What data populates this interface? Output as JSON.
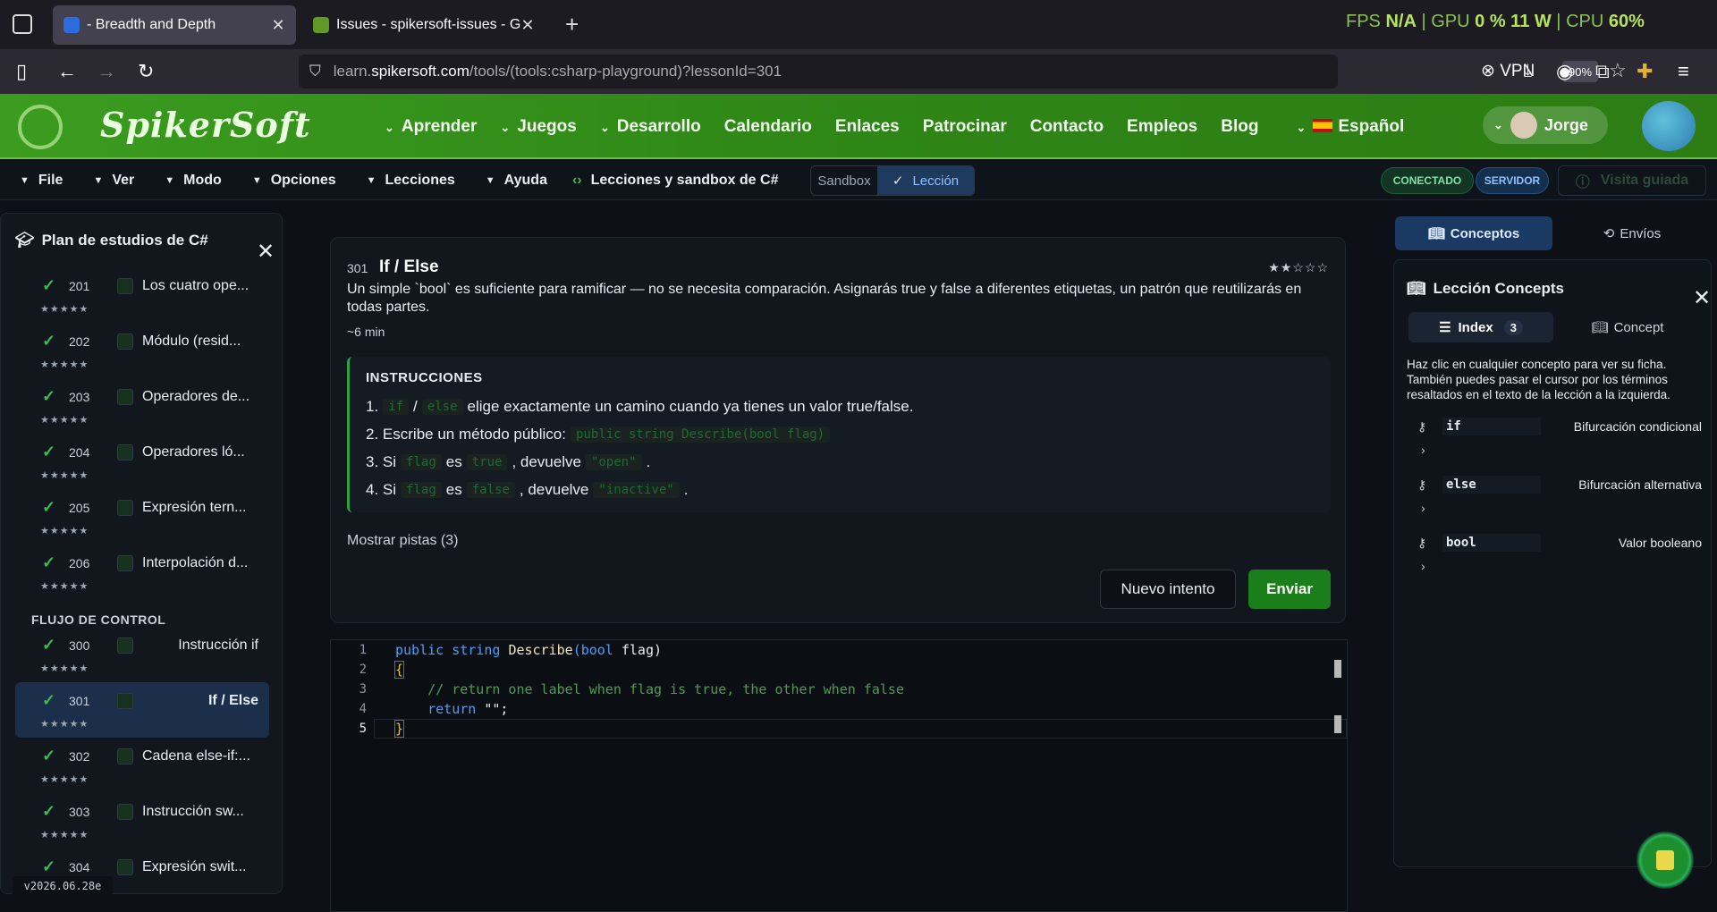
{
  "browser": {
    "tabs": [
      {
        "title": "- Breadth and Depth",
        "active": true,
        "favicon": "spikersoft-icon"
      },
      {
        "title": "Issues - spikersoft-issues - Gitea",
        "active": false,
        "favicon": "gitea-icon"
      }
    ],
    "url_prefix": "learn.",
    "url_domain": "spikersoft.com",
    "url_path": "/tools/(tools:csharp-playground)?lessonId=301",
    "zoom": "90%",
    "vpn_label": "VPN",
    "stats": {
      "fps_label": "FPS",
      "fps": "N/A",
      "gpu_label": "GPU",
      "gpu": "0 %",
      "power": "11 W",
      "cpu_label": "CPU",
      "cpu": "60%"
    }
  },
  "site": {
    "logo": "SpikerSoft",
    "nav": [
      {
        "label": "Aprender",
        "dropdown": true
      },
      {
        "label": "Juegos",
        "dropdown": true
      },
      {
        "label": "Desarrollo",
        "dropdown": true
      },
      {
        "label": "Calendario",
        "dropdown": false
      },
      {
        "label": "Enlaces",
        "dropdown": false
      },
      {
        "label": "Patrocinar",
        "dropdown": false
      },
      {
        "label": "Contacto",
        "dropdown": false
      },
      {
        "label": "Empleos",
        "dropdown": false
      },
      {
        "label": "Blog",
        "dropdown": false
      }
    ],
    "language": "Español",
    "user": "Jorge"
  },
  "menubar": {
    "items": [
      "File",
      "Ver",
      "Modo",
      "Opciones",
      "Lecciones",
      "Ayuda"
    ],
    "breadcrumb": "Lecciones y sandbox de C#",
    "mode_sandbox": "Sandbox",
    "mode_lesson": "Lección",
    "status_connected": "CONECTADO",
    "status_server": "SERVIDOR",
    "guided_tour": "Visita guiada"
  },
  "sidebar": {
    "title": "Plan de estudios de C#",
    "section_control": "FLUJO DE CONTROL",
    "stars": "★★★★★",
    "lessons_before": [
      {
        "num": "201",
        "title": "Los cuatro ope..."
      },
      {
        "num": "202",
        "title": "Módulo (resid..."
      },
      {
        "num": "203",
        "title": "Operadores de..."
      },
      {
        "num": "204",
        "title": "Operadores ló..."
      },
      {
        "num": "205",
        "title": "Expresión tern..."
      },
      {
        "num": "206",
        "title": "Interpolación d..."
      }
    ],
    "lessons_after": [
      {
        "num": "300",
        "title": "Instrucción if"
      },
      {
        "num": "301",
        "title": "If / Else",
        "selected": true
      },
      {
        "num": "302",
        "title": "Cadena else-if:..."
      },
      {
        "num": "303",
        "title": "Instrucción sw..."
      },
      {
        "num": "304",
        "title": "Expresión swit..."
      }
    ],
    "version": "v2026.06.28e"
  },
  "lesson": {
    "number": "301",
    "title": "If / Else",
    "rating": "★★☆☆☆",
    "description": "Un simple `bool` es suficiente para ramificar — no se necesita comparación. Asignarás true y false a diferentes etiquetas, un patrón que reutilizarás en todas partes.",
    "duration": "~6 min",
    "instructions_heading": "INSTRUCCIONES",
    "steps": [
      {
        "n": "1.",
        "code1": "if",
        "sep": "/",
        "code2": "else",
        "text": "elige exactamente un camino cuando ya tienes un valor true/false."
      },
      {
        "n": "2.",
        "text": "Escribe un método público:",
        "code": "public string Describe(bool flag)"
      },
      {
        "n": "3.",
        "si": "Si",
        "code1": "flag",
        "es": "es",
        "code2": "true",
        "devuelve": ", devuelve",
        "code3": "\"open\"",
        "end": "."
      },
      {
        "n": "4.",
        "si": "Si",
        "code1": "flag",
        "es": "es",
        "code2": "false",
        "devuelve": ", devuelve",
        "code3": "\"inactive\"",
        "end": "."
      }
    ],
    "show_hints": "Mostrar pistas (3)",
    "retry_button": "Nuevo intento",
    "submit_button": "Enviar"
  },
  "editor": {
    "line_numbers": [
      "1",
      "2",
      "3",
      "4",
      "5"
    ],
    "l1_kw1": "public",
    "l1_kw2": "string",
    "l1_fn": "Describe",
    "l1_paren": "(",
    "l1_kw3": "bool",
    "l1_rest": " flag)",
    "l2": "{",
    "l3": "    // return one label when flag is true, the other when false",
    "l4_kw": "return",
    "l4_str": " \"\";",
    "l5": "}"
  },
  "right_panel": {
    "tab_concepts": "Conceptos",
    "tab_submissions": "Envíos",
    "title": "Lección Concepts",
    "tab_index": "Index",
    "index_count": "3",
    "tab_concept": "Concept",
    "help": "Haz clic en cualquier concepto para ver su ficha. También puedes pasar el cursor por los términos resaltados en el texto de la lección a la izquierda.",
    "concepts": [
      {
        "term": "if",
        "definition": "Bifurcación condicional"
      },
      {
        "term": "else",
        "definition": "Bifurcación alternativa"
      },
      {
        "term": "bool",
        "definition": "Valor booleano"
      }
    ]
  }
}
